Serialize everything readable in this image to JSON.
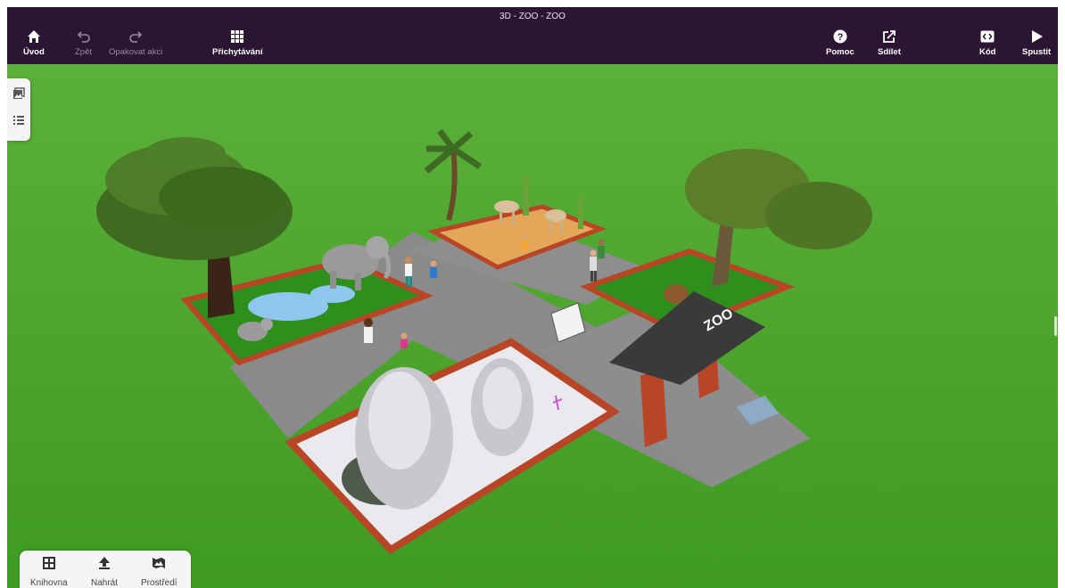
{
  "window": {
    "title": "3D - ZOO - ZOO"
  },
  "toolbar": {
    "home": {
      "label": "Úvod",
      "icon": "home-icon"
    },
    "undo": {
      "label": "Zpět",
      "icon": "undo-icon"
    },
    "redo": {
      "label": "Opakovat akci",
      "icon": "redo-icon"
    },
    "snap": {
      "label": "Přichytávání",
      "icon": "grid-icon"
    },
    "help": {
      "label": "Pomoc",
      "icon": "help-icon"
    },
    "share": {
      "label": "Sdílet",
      "icon": "share-icon"
    },
    "code": {
      "label": "Kód",
      "icon": "code-icon"
    },
    "play": {
      "label": "Spustit",
      "icon": "play-icon"
    }
  },
  "left_panel": {
    "items": [
      {
        "icon": "gallery-icon"
      },
      {
        "icon": "list-icon"
      }
    ]
  },
  "bottom_bar": {
    "library": {
      "label": "Knihovna",
      "icon": "library-icon"
    },
    "upload": {
      "label": "Nahrát",
      "icon": "upload-icon"
    },
    "environment": {
      "label": "Prostředí",
      "icon": "environment-icon"
    }
  },
  "scene": {
    "gate_sign": "ZOO",
    "colors": {
      "grass": "#4fa82f",
      "path": "#8b8b8b",
      "fence": "#b84526",
      "toolbar": "#2b1532"
    }
  }
}
